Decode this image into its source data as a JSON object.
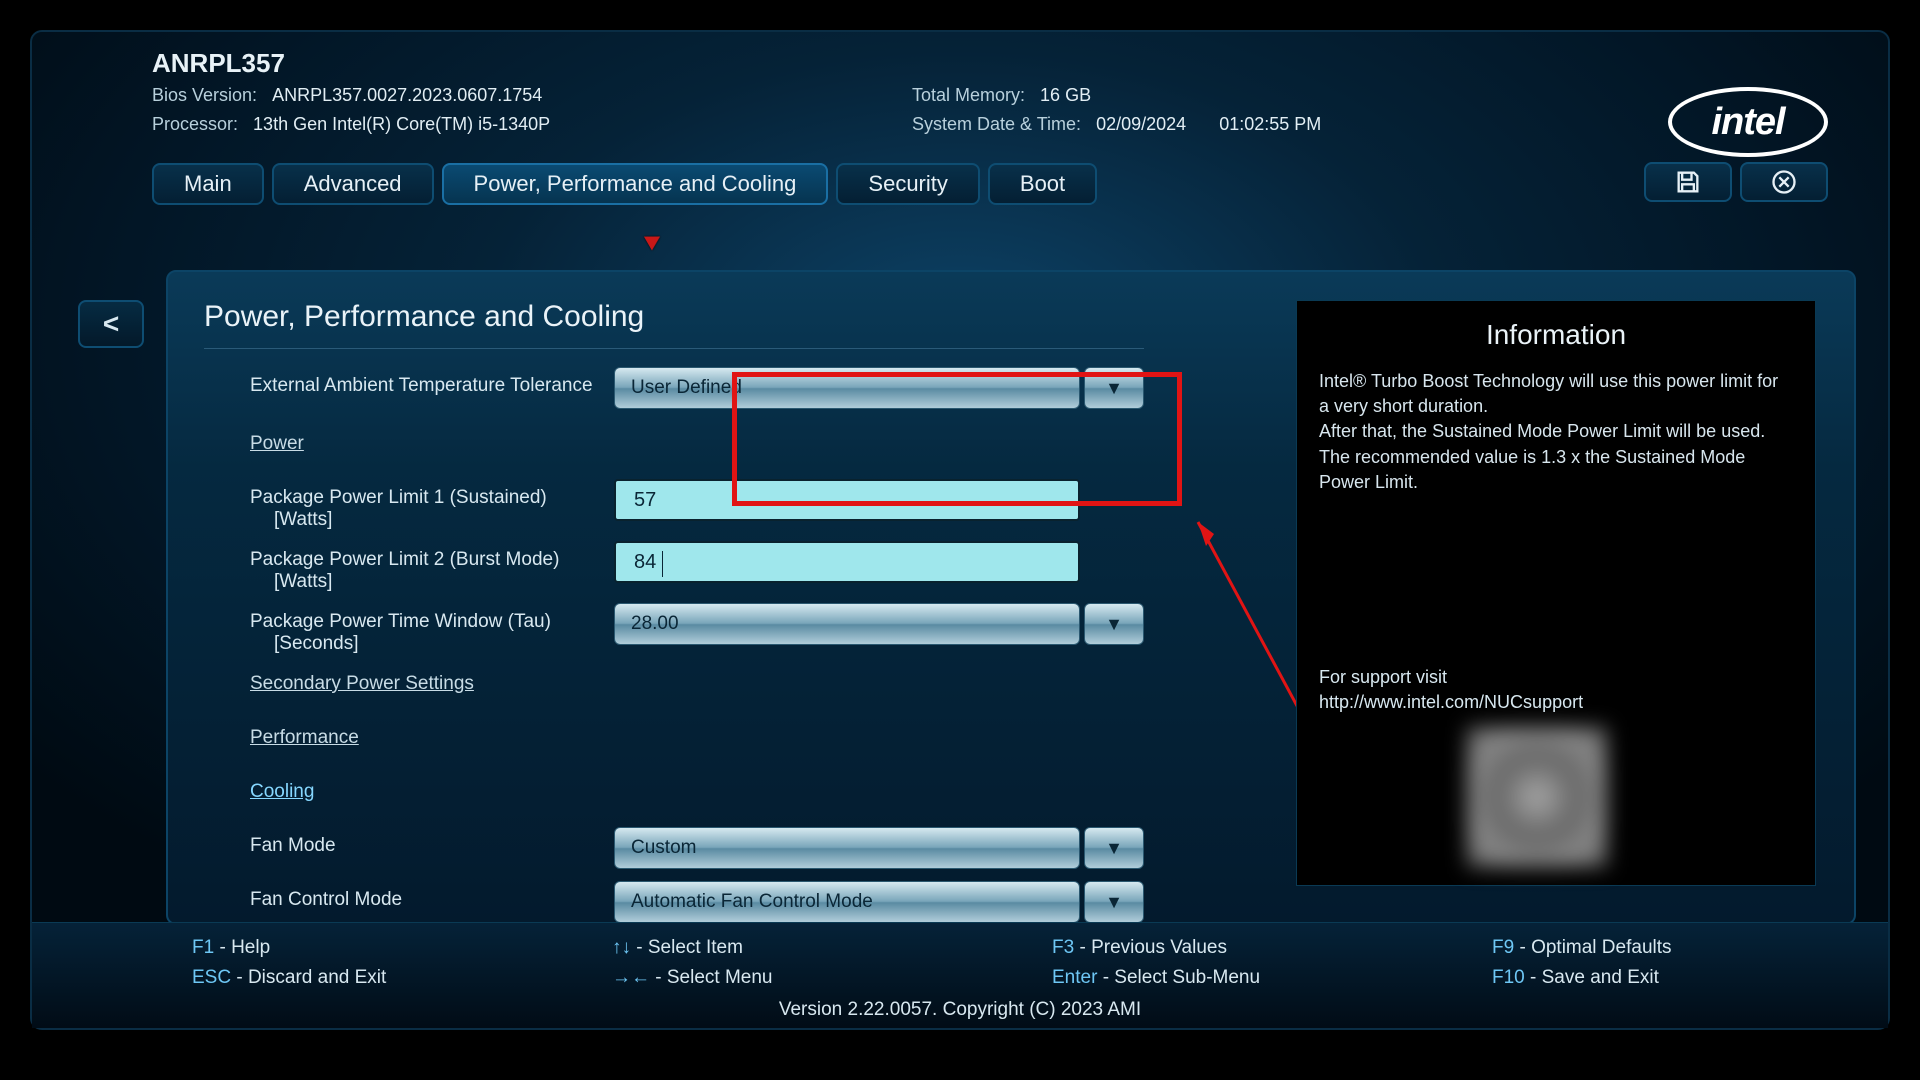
{
  "header": {
    "model": "ANRPL357",
    "bios_label": "Bios Version:",
    "bios_value": "ANRPL357.0027.2023.0607.1754",
    "proc_label": "Processor:",
    "proc_value": "13th Gen Intel(R) Core(TM) i5-1340P",
    "mem_label": "Total Memory:",
    "mem_value": "16 GB",
    "date_label": "System Date & Time:",
    "date_value": "02/09/2024",
    "time_value": "01:02:55 PM",
    "logo_text": "intel"
  },
  "tabs": {
    "main": "Main",
    "advanced": "Advanced",
    "ppc": "Power, Performance and Cooling",
    "security": "Security",
    "boot": "Boot"
  },
  "back_btn": "<",
  "panel": {
    "title": "Power, Performance and Cooling",
    "ext_temp_label": "External Ambient Temperature Tolerance",
    "ext_temp_value": "User Defined",
    "power_link": "Power",
    "pl1_label": "Package Power Limit 1 (Sustained)",
    "pl1_sub": "[Watts]",
    "pl1_value": "57",
    "pl2_label": "Package Power Limit 2 (Burst Mode)",
    "pl2_sub": "[Watts]",
    "pl2_value": "84",
    "tau_label": "Package Power Time Window (Tau)",
    "tau_sub": "[Seconds]",
    "tau_value": "28.00",
    "sec_power_link": "Secondary Power Settings",
    "perf_link": "Performance",
    "cooling_link": "Cooling",
    "fan_mode_label": "Fan Mode",
    "fan_mode_value": "Custom",
    "fan_ctrl_label": "Fan Control Mode",
    "fan_ctrl_value": "Automatic Fan Control Mode"
  },
  "info": {
    "title": "Information",
    "body": "Intel® Turbo Boost Technology will use this power limit for a very short duration.\nAfter that, the Sustained Mode Power Limit will be used.\nThe recommended value is 1.3 x the Sustained Mode Power Limit.",
    "support_label": "For support visit",
    "support_url": "http://www.intel.com/NUCsupport"
  },
  "footer": {
    "f1": "F1",
    "f1_t": " - Help",
    "esc": "ESC",
    "esc_t": " - Discard and Exit",
    "updown": "↑↓",
    "updown_t": " - Select Item",
    "leftright": "→←",
    "leftright_t": " - Select Menu",
    "f3": "F3",
    "f3_t": " - Previous Values",
    "enter": "Enter",
    "enter_t": " - Select Sub-Menu",
    "f9": "F9",
    "f9_t": " - Optimal Defaults",
    "f10": "F10",
    "f10_t": " - Save and Exit",
    "version": "Version 2.22.0057. Copyright (C) 2023 AMI"
  }
}
